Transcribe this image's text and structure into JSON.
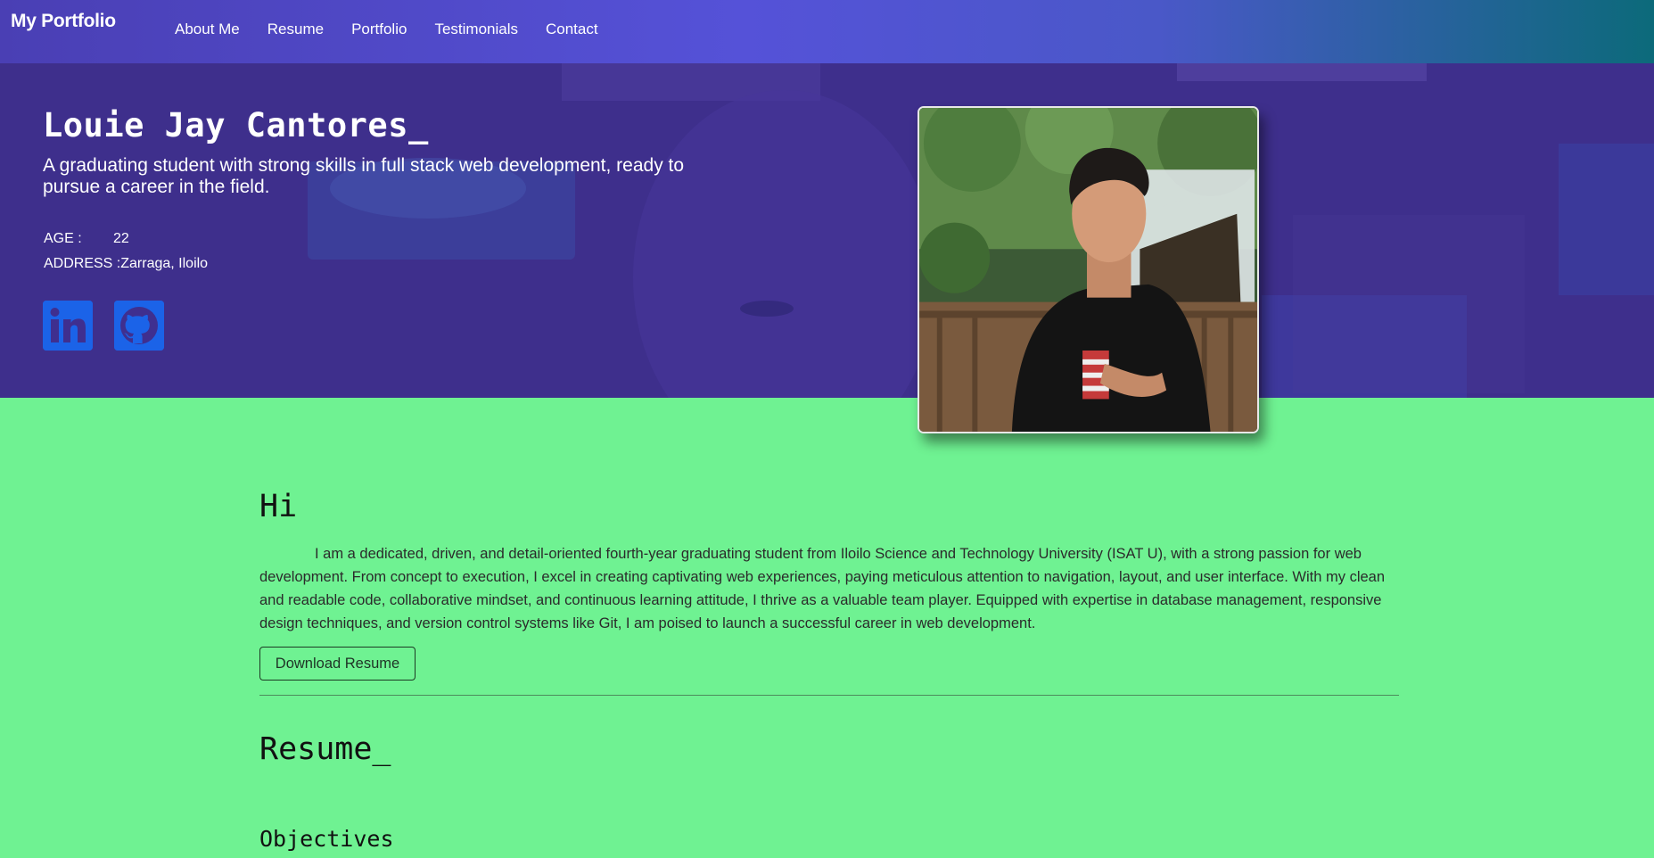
{
  "navbar": {
    "brand": "My Portfolio",
    "links": [
      "About Me",
      "Resume",
      "Portfolio",
      "Testimonials",
      "Contact"
    ]
  },
  "hero": {
    "name": "Louie Jay Cantores_",
    "tagline": "A graduating student with strong skills in full stack web development, ready to pursue a career in the field.",
    "age_label": "AGE :",
    "age_value": "22",
    "address_label": "ADDRESS :",
    "address_value": "Zarraga, Iloilo",
    "socials": [
      {
        "name": "LinkedIn",
        "icon": "linkedin-icon"
      },
      {
        "name": "GitHub",
        "icon": "github-icon"
      }
    ]
  },
  "about": {
    "greeting": "Hi",
    "paragraph": "I am a dedicated, driven, and detail-oriented fourth-year graduating student from Iloilo Science and Technology University (ISAT U), with a strong passion for web development. From concept to execution, I excel in creating captivating web experiences, paying meticulous attention to navigation, layout, and user interface. With my clean and readable code, collaborative mindset, and continuous learning attitude, I thrive as a valuable team player. Equipped with expertise in database management, responsive design techniques, and version control systems like Git, I am poised to launch a successful career in web development.",
    "download_label": "Download Resume"
  },
  "resume": {
    "title": "Resume_",
    "objectives_title": "Objectives"
  },
  "colors": {
    "nav_gradient_start": "#4a3fb4",
    "nav_gradient_end": "#0c6a7a",
    "hero_overlay": "#3f2f8f",
    "page_background": "#6ff292",
    "social_icon": "#1b63e8"
  }
}
